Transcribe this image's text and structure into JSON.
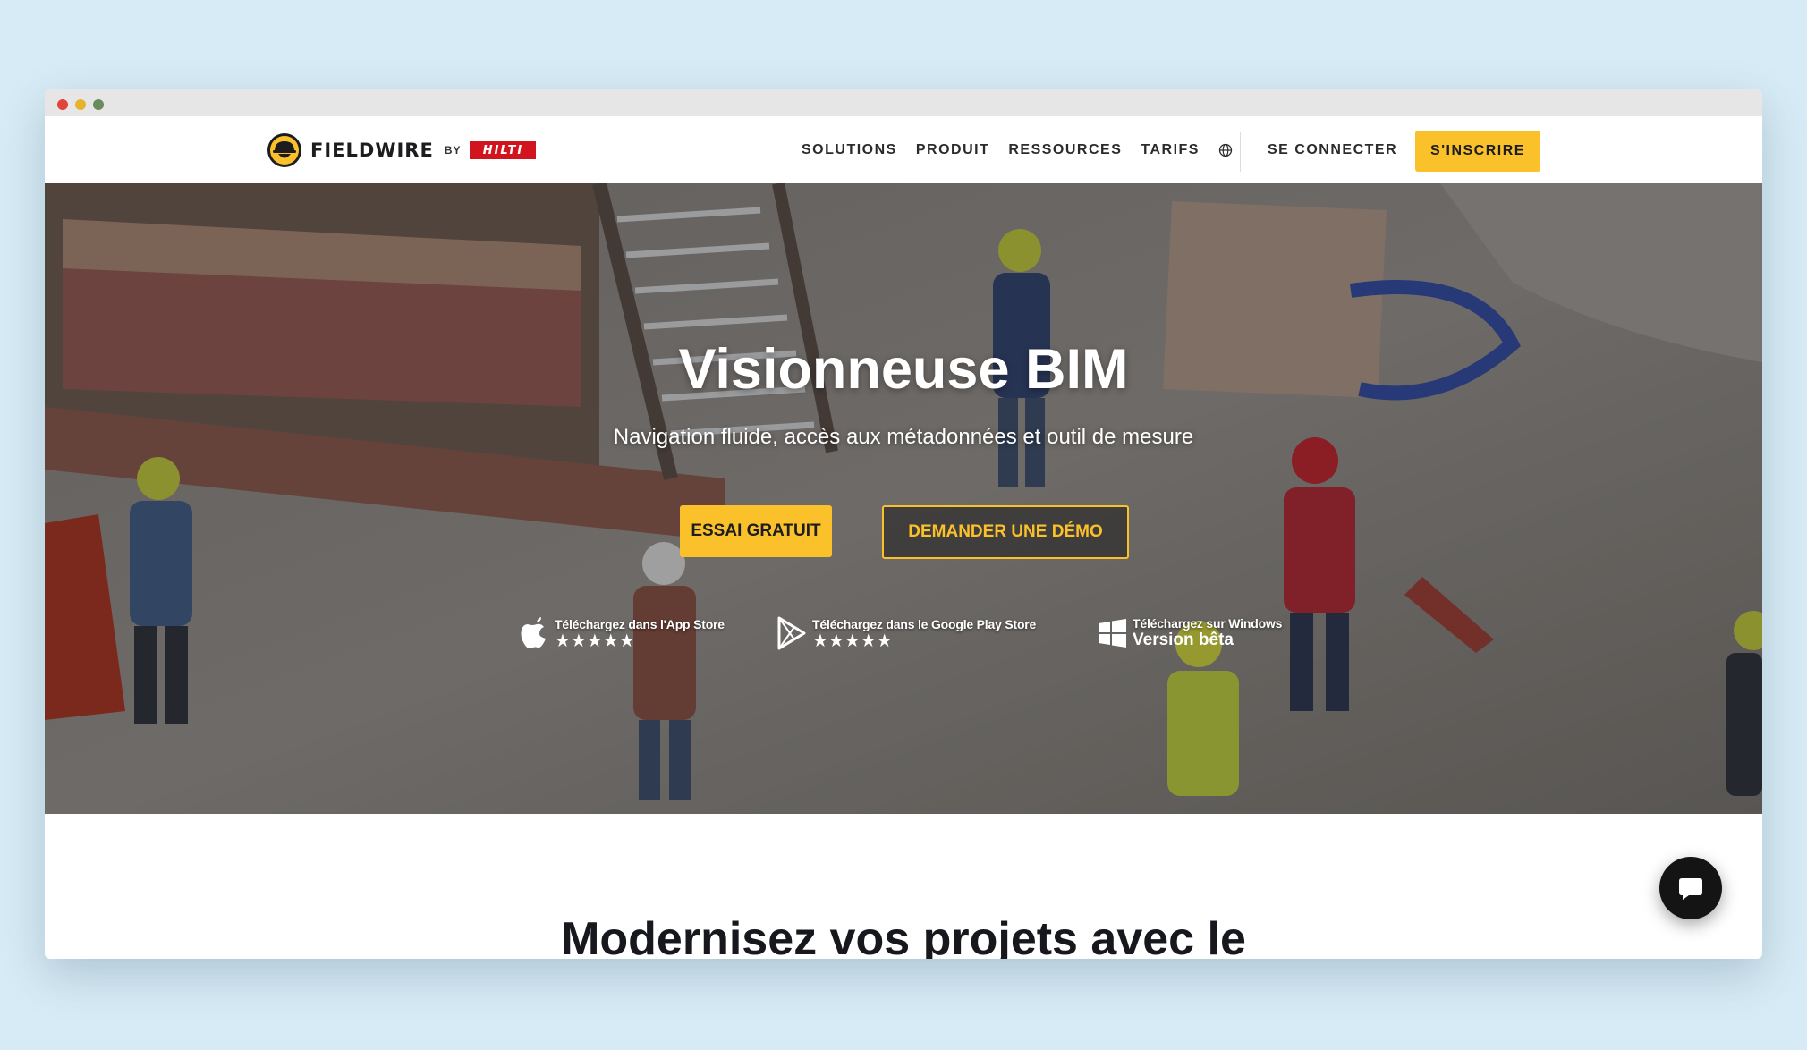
{
  "brand": {
    "name": "FIELDWIRE",
    "by": "BY",
    "partner": "HILTI"
  },
  "nav": {
    "items": [
      {
        "label": "SOLUTIONS"
      },
      {
        "label": "PRODUIT"
      },
      {
        "label": "RESSOURCES"
      },
      {
        "label": "TARIFS"
      }
    ],
    "language_icon": "globe-icon",
    "login_label": "SE CONNECTER",
    "signup_label": "S'INSCRIRE"
  },
  "hero": {
    "title": "Visionneuse BIM",
    "subtitle": "Navigation fluide, accès aux métadonnées et outil de mesure",
    "primary_cta": "ESSAI GRATUIT",
    "secondary_cta": "DEMANDER UNE DÉMO",
    "stores": [
      {
        "icon": "apple-icon",
        "label": "Téléchargez dans l'App Store",
        "rating": 5
      },
      {
        "icon": "google-play-icon",
        "label": "Téléchargez dans le Google Play Store",
        "rating": 5
      },
      {
        "icon": "windows-icon",
        "label": "Téléchargez sur Windows",
        "sub": "Version bêta"
      }
    ]
  },
  "section": {
    "heading": "Modernisez vos projets avec le"
  },
  "chat": {
    "icon": "chat-bubble-icon"
  },
  "colors": {
    "accent": "#fbc12b",
    "hilti_red": "#d2141e",
    "text_dark": "#1d1d1f",
    "page_background": "#d6ebf5"
  }
}
